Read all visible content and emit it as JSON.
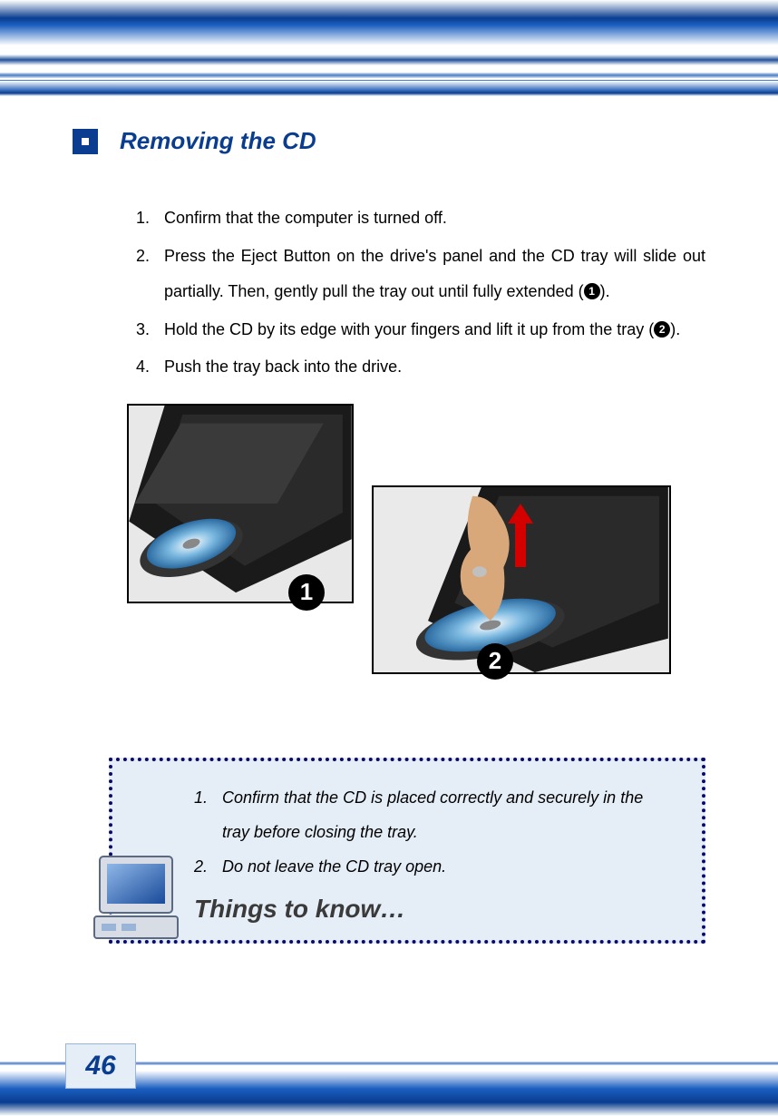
{
  "heading": "Removing the CD",
  "steps": [
    {
      "num": "1.",
      "text_before": "Confirm that the computer is turned off.",
      "marker": "",
      "text_after": ""
    },
    {
      "num": "2.",
      "text_before": "Press the Eject Button on the drive's panel and the CD tray will slide out partially.  Then, gently pull the tray out until fully extended (",
      "marker": "1",
      "text_after": ")."
    },
    {
      "num": "3.",
      "text_before": "Hold the CD by its edge with your fingers and lift it up from the tray (",
      "marker": "2",
      "text_after": ")."
    },
    {
      "num": "4.",
      "text_before": "Push the tray back into the drive.",
      "marker": "",
      "text_after": ""
    }
  ],
  "image_badges": {
    "first": "1",
    "second": "2"
  },
  "callout": {
    "items": [
      {
        "num": "1.",
        "text": "Confirm that the CD is placed correctly and securely in the tray before closing the tray."
      },
      {
        "num": "2.",
        "text": "Do not leave the CD tray open."
      }
    ],
    "title": "Things to know…"
  },
  "page_number": "46"
}
